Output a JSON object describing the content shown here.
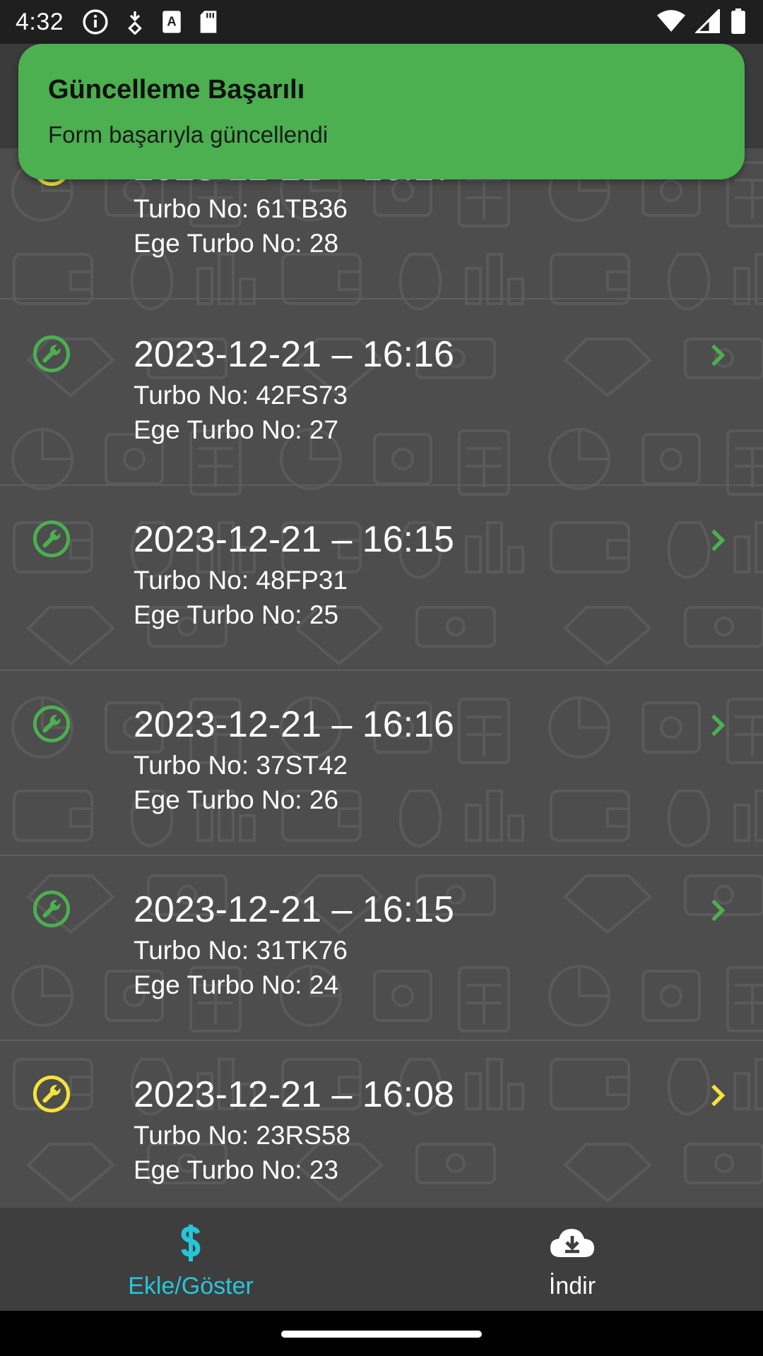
{
  "status_bar": {
    "time": "4:32",
    "left_icons": [
      "info-icon",
      "data-saver-icon",
      "keyboard-a-icon",
      "sd-card-icon"
    ],
    "right_icons": [
      "wifi-icon",
      "cell-signal-icon",
      "battery-icon"
    ]
  },
  "toast": {
    "title": "Güncelleme Başarılı",
    "message": "Form başarıyla güncellendi",
    "color": "#4caf50"
  },
  "list": {
    "items": [
      {
        "title": "2023-12-21 – 16:17",
        "turbo": "Turbo No: 61TB36",
        "ege": "Ege Turbo No: 28",
        "status_color": "#f4e33b",
        "icon": "wrench-icon"
      },
      {
        "title": "2023-12-21 – 16:16",
        "turbo": "Turbo No: 42FS73",
        "ege": "Ege Turbo No: 27",
        "status_color": "#4caf50",
        "icon": "wrench-icon"
      },
      {
        "title": "2023-12-21 – 16:15",
        "turbo": "Turbo No: 48FP31",
        "ege": "Ege Turbo No: 25",
        "status_color": "#4caf50",
        "icon": "wrench-icon"
      },
      {
        "title": "2023-12-21 – 16:16",
        "turbo": "Turbo No: 37ST42",
        "ege": "Ege Turbo No: 26",
        "status_color": "#4caf50",
        "icon": "wrench-icon"
      },
      {
        "title": "2023-12-21 – 16:15",
        "turbo": "Turbo No: 31TK76",
        "ege": "Ege Turbo No: 24",
        "status_color": "#4caf50",
        "icon": "wrench-icon"
      },
      {
        "title": "2023-12-21 – 16:08",
        "turbo": "Turbo No: 23RS58",
        "ege": "Ege Turbo No: 23",
        "status_color": "#f4e33b",
        "icon": "wrench-icon"
      }
    ]
  },
  "bottom_nav": {
    "items": [
      {
        "label": "Ekle/Göster",
        "icon": "dollar-icon",
        "active": true,
        "color": "#26c6da"
      },
      {
        "label": "İndir",
        "icon": "cloud-download-icon",
        "active": false,
        "color": "#ffffff"
      }
    ]
  }
}
